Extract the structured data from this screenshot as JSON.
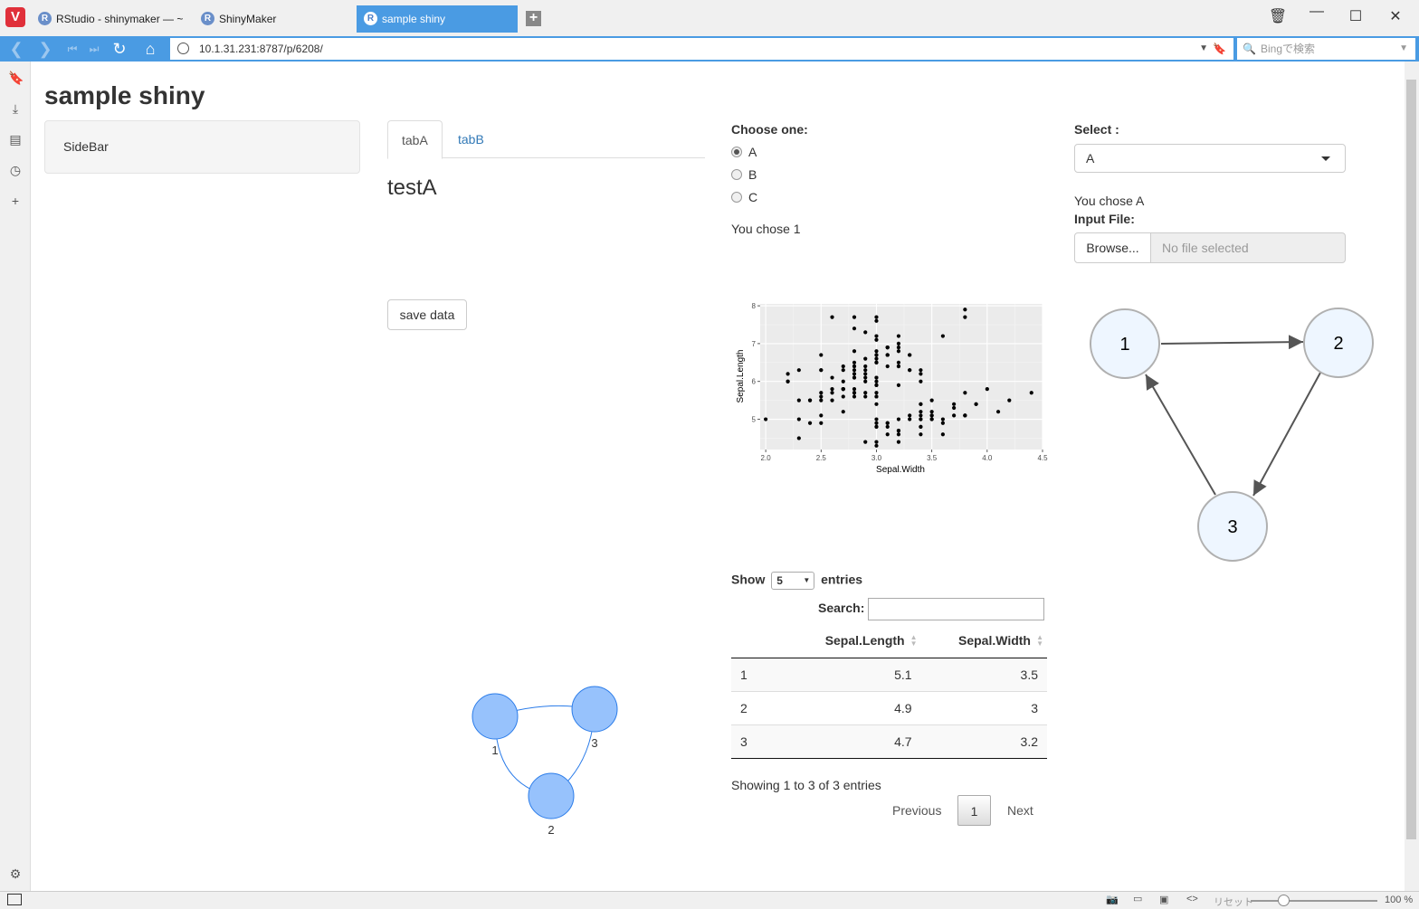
{
  "browser": {
    "tabs": [
      {
        "label": "RStudio - shinymaker — ~"
      },
      {
        "label": "ShinyMaker"
      },
      {
        "label": "sample shiny"
      }
    ],
    "url": "10.1.31.231:8787/p/6208/",
    "search_placeholder": "Bingで検索",
    "zoom": "100 %",
    "reset_label": "リセット"
  },
  "app": {
    "title": "sample shiny",
    "sidebar_text": "SideBar",
    "tabs": [
      {
        "label": "tabA"
      },
      {
        "label": "tabB"
      }
    ],
    "tab_content": "testA",
    "save_button": "save data",
    "radio": {
      "label": "Choose one:",
      "options": [
        "A",
        "B",
        "C"
      ],
      "selected": "A",
      "output": "You chose 1"
    },
    "select": {
      "label": "Select :",
      "value": "A",
      "output": "You chose A"
    },
    "file_input": {
      "label": "Input File:",
      "button": "Browse...",
      "placeholder": "No file selected"
    },
    "datatable": {
      "show_label": "Show",
      "length_value": "5",
      "entries_label": "entries",
      "search_label": "Search:",
      "columns": [
        "",
        "Sepal.Length",
        "Sepal.Width"
      ],
      "rows": [
        [
          "1",
          "5.1",
          "3.5"
        ],
        [
          "2",
          "4.9",
          "3"
        ],
        [
          "3",
          "4.7",
          "3.2"
        ]
      ],
      "info": "Showing 1 to 3 of 3 entries",
      "previous": "Previous",
      "page": "1",
      "next": "Next"
    },
    "network_small": {
      "nodes": [
        "1",
        "3",
        "2"
      ],
      "node_color": "#97c2fc",
      "edge_color": "#2b7ce9"
    },
    "network_large": {
      "nodes": [
        "1",
        "2",
        "3"
      ],
      "edges": [
        [
          "1",
          "2"
        ],
        [
          "2",
          "3"
        ],
        [
          "3",
          "1"
        ]
      ],
      "node_fill": "#eef6ff",
      "node_stroke": "#aaaaaa"
    }
  },
  "chart_data": {
    "type": "scatter",
    "xlabel": "Sepal.Width",
    "ylabel": "Sepal.Length",
    "xlim": [
      1.95,
      4.5
    ],
    "ylim": [
      4.2,
      8.05
    ],
    "xticks": [
      "2.0",
      "2.5",
      "3.0",
      "3.5",
      "4.0",
      "4.5"
    ],
    "yticks": [
      "5",
      "6",
      "7",
      "8"
    ],
    "grid": true,
    "background": "#ebebeb",
    "x": [
      3.5,
      3.0,
      3.2,
      3.1,
      3.6,
      3.9,
      3.4,
      3.4,
      2.9,
      3.1,
      3.7,
      3.4,
      3.0,
      3.0,
      4.0,
      4.4,
      3.9,
      3.5,
      3.8,
      3.8,
      3.4,
      3.7,
      3.6,
      3.3,
      3.4,
      3.0,
      3.4,
      3.5,
      3.4,
      3.2,
      3.1,
      3.4,
      4.1,
      4.2,
      3.1,
      3.2,
      3.5,
      3.6,
      3.0,
      3.4,
      3.5,
      2.3,
      3.2,
      3.5,
      3.8,
      3.0,
      3.8,
      3.2,
      3.7,
      3.3,
      3.2,
      3.2,
      3.1,
      2.3,
      2.8,
      2.8,
      3.3,
      2.4,
      2.9,
      2.7,
      2.0,
      3.0,
      2.2,
      2.9,
      2.9,
      3.1,
      3.0,
      2.7,
      2.2,
      2.5,
      3.2,
      2.8,
      2.5,
      2.8,
      2.9,
      3.0,
      2.8,
      3.0,
      2.9,
      2.6,
      2.4,
      2.4,
      2.7,
      2.7,
      3.0,
      3.4,
      3.1,
      2.3,
      3.0,
      2.5,
      2.6,
      3.0,
      2.6,
      2.3,
      2.7,
      3.0,
      2.9,
      2.9,
      2.5,
      2.8,
      3.3,
      2.7,
      3.0,
      2.9,
      3.0,
      3.0,
      2.5,
      2.9,
      2.5,
      3.6,
      3.2,
      2.7,
      3.0,
      2.5,
      2.8,
      3.2,
      3.0,
      3.8,
      2.6,
      2.2,
      3.2,
      2.8,
      2.8,
      2.7,
      3.3,
      3.2,
      2.8,
      3.0,
      2.8,
      3.0,
      2.8,
      3.8,
      2.8,
      2.8,
      2.6,
      3.0,
      3.4,
      3.1,
      3.0,
      3.1,
      3.1,
      3.1,
      2.7,
      3.2,
      3.3,
      3.0,
      2.5,
      3.0,
      3.4,
      3.0
    ],
    "y": [
      5.1,
      4.9,
      4.7,
      4.6,
      5.0,
      5.4,
      4.6,
      5.0,
      4.4,
      4.9,
      5.4,
      4.8,
      4.8,
      4.3,
      5.8,
      5.7,
      5.4,
      5.1,
      5.7,
      5.1,
      5.4,
      5.1,
      4.6,
      5.1,
      4.8,
      5.0,
      5.0,
      5.2,
      5.2,
      4.7,
      4.8,
      5.4,
      5.2,
      5.5,
      4.9,
      5.0,
      5.5,
      4.9,
      4.4,
      5.1,
      5.0,
      4.5,
      4.4,
      5.0,
      5.1,
      4.8,
      5.1,
      4.6,
      5.3,
      5.0,
      7.0,
      6.4,
      6.9,
      5.5,
      6.5,
      5.7,
      6.3,
      4.9,
      6.6,
      5.2,
      5.0,
      5.9,
      6.0,
      6.1,
      5.6,
      6.7,
      5.6,
      5.8,
      6.2,
      5.6,
      5.9,
      6.1,
      6.3,
      6.1,
      6.4,
      6.6,
      6.8,
      6.7,
      6.0,
      5.7,
      5.5,
      5.5,
      5.8,
      6.0,
      5.4,
      6.0,
      6.7,
      6.3,
      5.6,
      5.5,
      5.5,
      6.1,
      5.8,
      5.0,
      5.6,
      5.7,
      5.7,
      6.2,
      5.1,
      5.7,
      6.3,
      5.8,
      7.1,
      6.3,
      6.5,
      7.6,
      4.9,
      7.3,
      6.7,
      7.2,
      6.5,
      6.4,
      6.8,
      5.7,
      5.8,
      6.4,
      6.5,
      7.7,
      7.7,
      6.0,
      6.9,
      5.6,
      7.7,
      6.3,
      6.7,
      7.2,
      6.2,
      6.1,
      6.4,
      7.2,
      7.4,
      7.9,
      6.4,
      6.3,
      6.1,
      7.7,
      6.3,
      6.4,
      6.0,
      6.9,
      6.7,
      6.9,
      5.8,
      6.8,
      6.7,
      6.7,
      6.3,
      6.5,
      6.2,
      5.9
    ]
  }
}
